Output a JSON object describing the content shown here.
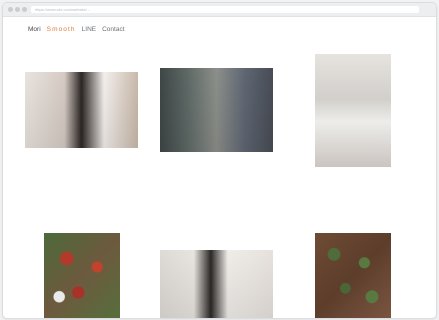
{
  "browser": {
    "address": "https://www.wix.com/website/..."
  },
  "nav": {
    "brand": "Mori",
    "accent": "Smooth",
    "link1": "LINE",
    "link2": "Contact"
  },
  "gallery": {
    "photos": [
      {
        "alt": "woman-with-dark-hair-hand-on-face"
      },
      {
        "alt": "woman-in-phone-booth-green-receiver"
      },
      {
        "alt": "woman-holding-white-lilies"
      },
      {
        "alt": "red-flower-field-top-view"
      },
      {
        "alt": "woman-in-white-shirt-hair-moving"
      },
      {
        "alt": "plant-rows-in-soil-top-view"
      }
    ]
  },
  "colors": {
    "accent": "#e07a3a",
    "nav_text": "#555a5f",
    "window_bg": "#ffffff"
  }
}
